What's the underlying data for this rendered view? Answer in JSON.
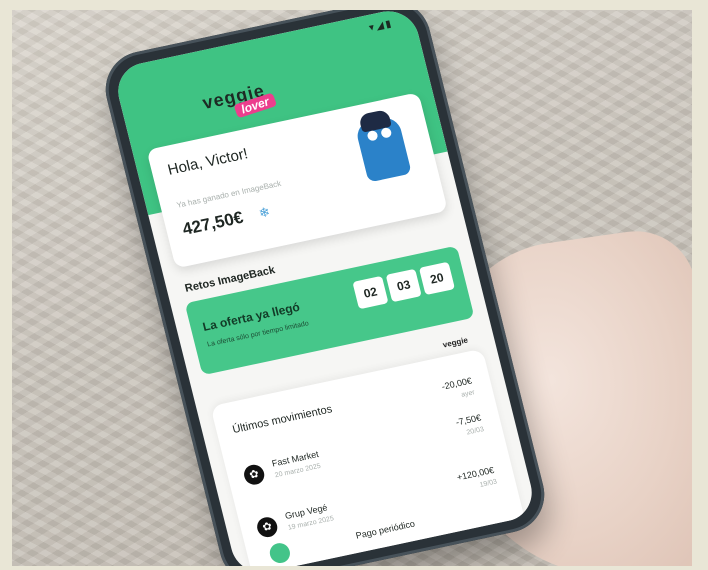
{
  "status_bar": {
    "icons": "▾◢▮"
  },
  "logo": {
    "word": "veggie",
    "badge": "lover"
  },
  "account_card": {
    "greeting": "Hola, Victor!",
    "subtitle": "Ya has ganado en ImageBack",
    "amount": "427,50€",
    "amount_icon": "❄"
  },
  "promo": {
    "section_title": "Retos ImageBack",
    "title": "La oferta ya llegó",
    "subtitle": "La oferta sólo por tiempo limitado",
    "countdown": [
      "02",
      "03",
      "20"
    ]
  },
  "link": {
    "label": "veggie"
  },
  "movements": {
    "title": "Últimos movimientos",
    "items": [
      {
        "icon": "✿",
        "name": "",
        "date": "",
        "amount": "-20,00€",
        "amount_sub": "ayer"
      },
      {
        "icon": "✿",
        "name": "Fast Market",
        "date": "20 marzo 2025",
        "amount": "-7,50€",
        "amount_sub": "20/03"
      },
      {
        "icon": "✿",
        "name": "Grup Vegé",
        "date": "19 marzo 2025",
        "amount": "+120,00€",
        "amount_sub": "19/03"
      }
    ],
    "footer": "Pago periódico"
  },
  "colors": {
    "brand_green": "#3fc383",
    "accent_pink": "#ec3e8d",
    "mascot_blue": "#2b82c9"
  }
}
